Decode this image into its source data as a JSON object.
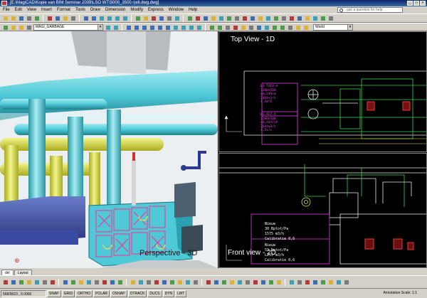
{
  "window": {
    "title": "[E:\\MagiCAD\\Kopie van BIM Seminar 2009\\LSO WT\\5000_3500 r)ell.dwg.dwg]"
  },
  "menu": [
    "File",
    "Edit",
    "View",
    "Insert",
    "Format",
    "Tools",
    "Draw",
    "Dimension",
    "Modify",
    "Express",
    "Window",
    "Help"
  ],
  "help_search": {
    "placeholder": "ype a question for help"
  },
  "toolbar": {
    "layer_dropdown": "MAGI_GARBAGE",
    "workspace_dropdown": "World"
  },
  "viewports": {
    "perspective": {
      "label": "Perspective - 3D"
    },
    "top": {
      "label": "Top View - 1D",
      "tag1": [
        "LU-TOEV-A",
        "3200x500",
        "qk=248+m",
        "2460+3/h",
        "1.3V/Z"
      ],
      "tag2": [
        "LU-AFZ-A",
        "3200x500",
        "qk=1047+A",
        "2644m3/h",
        "1.2x/s"
      ]
    },
    "front": {
      "label": "Front view - 2D",
      "tag1": [
        "Nieuw",
        "30 Bptot/Pa",
        "1575 m3/h",
        "Calibratie 0,6"
      ],
      "tag2": [
        "Nieuw",
        "53 Dptot/Pa",
        "L255 m3/h",
        "Calibratie 0,6"
      ]
    }
  },
  "tabs": [
    "del",
    "Layout"
  ],
  "status": {
    "coords": "568/9023 , 0.0000",
    "modes": [
      "SNAP",
      "GRID",
      "ORTHO",
      "POLAR",
      "OSNAP",
      "OTRACK",
      "DUCS",
      "DYN",
      "LWT"
    ],
    "annotation_scale": "Annotation Scale: 1:1"
  },
  "colors": {
    "duct_cyan": "#4fc9d8",
    "pipe_yellow": "#e6e84a",
    "cad_magenta": "#e040e0",
    "cad_green": "#3cd14a",
    "cad_red": "#e33a3a"
  }
}
